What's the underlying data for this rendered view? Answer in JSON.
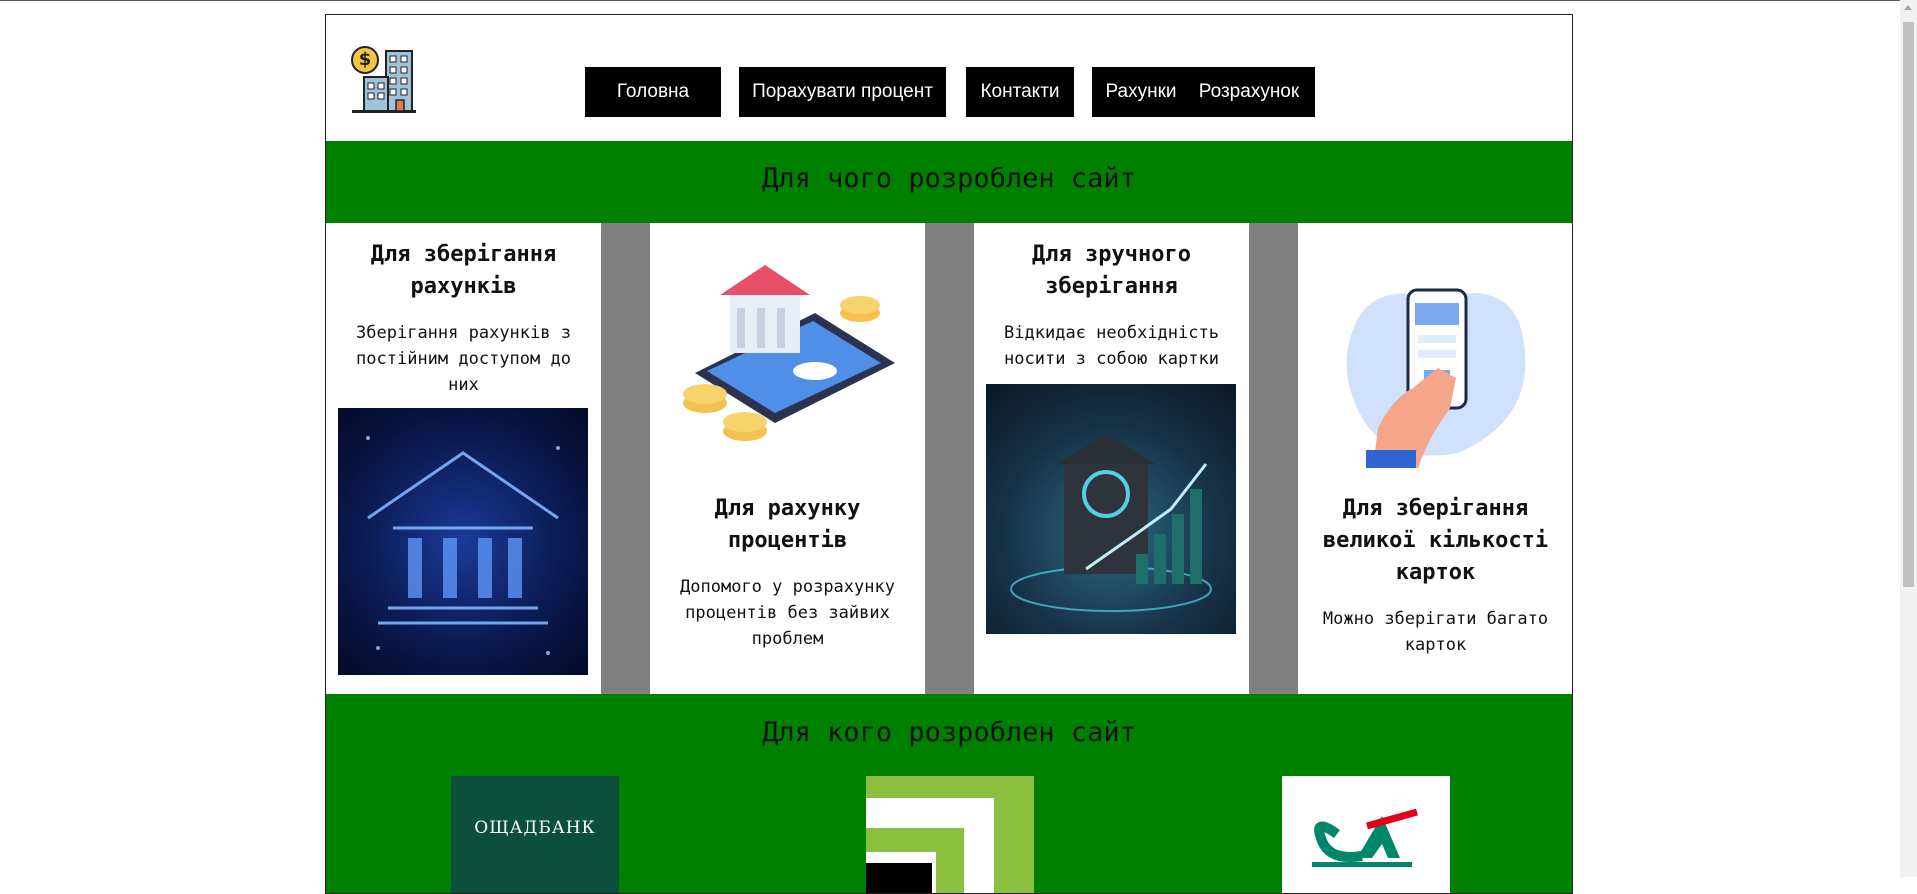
{
  "nav": {
    "items": [
      {
        "label": "Головна"
      },
      {
        "label": "Порахувати процент"
      },
      {
        "label": "Контакти"
      },
      {
        "label": "Рахунки"
      },
      {
        "label": "Розрахунок"
      }
    ]
  },
  "section1": {
    "title": "Для чого розроблен сайт",
    "cards": [
      {
        "title": "Для зберігання рахунків",
        "text": "Зберігання рахунків з постійним доступом до них"
      },
      {
        "title": "Для рахунку процентів",
        "text": "Допомого у розрахунку процентів без зайвих проблем"
      },
      {
        "title": "Для зручного зберігання",
        "text": "Відкидає необхідність носити з собою картки"
      },
      {
        "title": "Для зберігання великої кількості карток",
        "text": "Можно зберігати багато карток"
      }
    ]
  },
  "section2": {
    "title": "Для кого розроблен сайт",
    "partners": [
      {
        "name": "ОЩАДБАНК"
      },
      {
        "name": "privatbank-logo"
      },
      {
        "name": "credit-agricole-logo"
      }
    ]
  },
  "colors": {
    "band": "#008000",
    "nav_bg": "#000000",
    "gray_strip": "#808080"
  },
  "icons": [
    "bank-building-logo-icon",
    "dollar-coin-icon"
  ]
}
